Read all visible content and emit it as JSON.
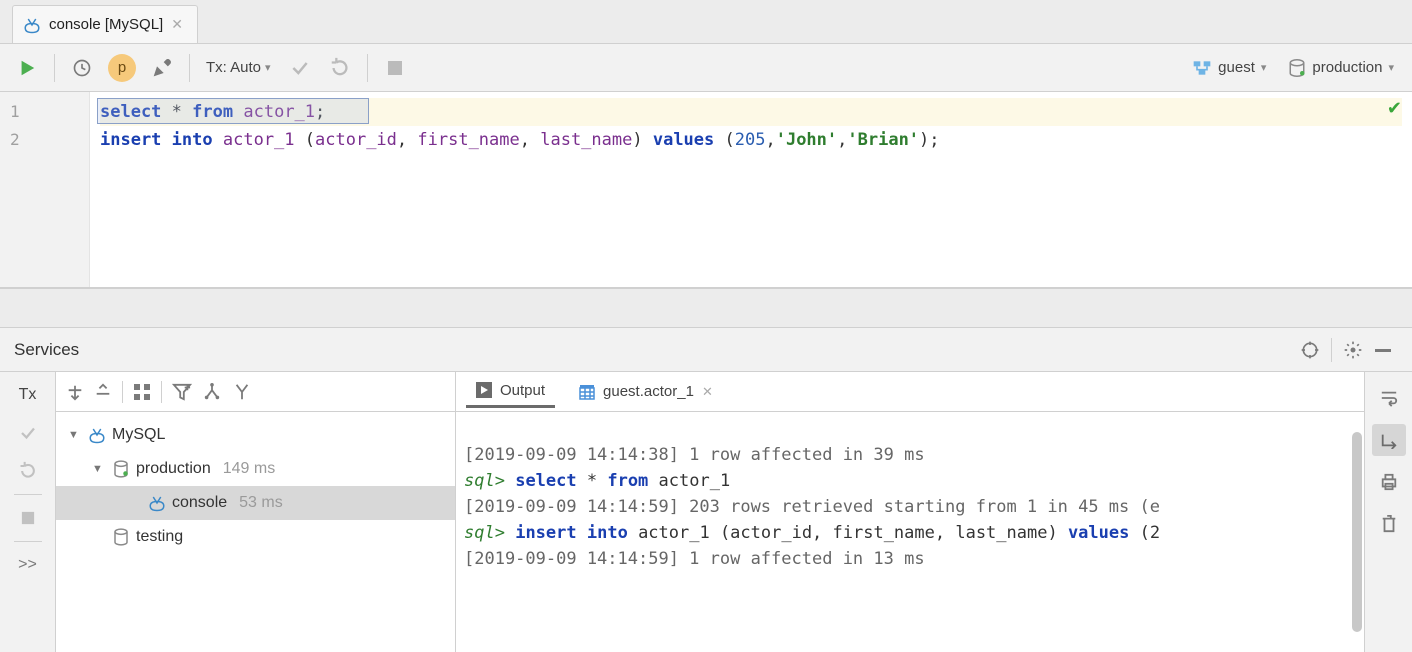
{
  "tab": {
    "title": "console [MySQL]"
  },
  "toolbar": {
    "tx_label": "Tx: Auto",
    "right_user": "guest",
    "right_schema": "production"
  },
  "editor": {
    "lines": [
      {
        "n": "1",
        "tokens": [
          "select",
          " ",
          "*",
          " ",
          "from",
          " ",
          "actor_1",
          ";"
        ]
      },
      {
        "n": "2",
        "tokens": [
          "insert",
          " ",
          "into",
          " ",
          "actor_1",
          " (",
          "actor_id",
          ", ",
          "first_name",
          ", ",
          "last_name",
          ") ",
          "values",
          " (",
          "205",
          ",",
          "'John'",
          ",",
          "'Brian'",
          ");"
        ]
      }
    ]
  },
  "services": {
    "title": "Services",
    "left_tx": "Tx",
    "more": ">>",
    "tree": {
      "root": {
        "label": "MySQL"
      },
      "prod": {
        "label": "production",
        "ms": "149 ms"
      },
      "console": {
        "label": "console",
        "ms": "53 ms"
      },
      "testing": {
        "label": "testing"
      }
    }
  },
  "output": {
    "tab_output": "Output",
    "tab_data": "guest.actor_1",
    "lines": {
      "l0": "[2019-09-09 14:14:38] 1 row affected in 39 ms",
      "l1_prompt": "sql>",
      "l1_kw1": "select",
      "l1_mid": " * ",
      "l1_kw2": "from",
      "l1_rest": " actor_1",
      "l2": "[2019-09-09 14:14:59] 203 rows retrieved starting from 1 in 45 ms (e",
      "l3_prompt": "sql>",
      "l3_kw1": "insert",
      "l3_sp": " ",
      "l3_kw2": "into",
      "l3_mid": " actor_1 (actor_id, first_name, last_name) ",
      "l3_kw3": "values",
      "l3_rest": " (2",
      "l4": "[2019-09-09 14:14:59] 1 row affected in 13 ms"
    }
  }
}
